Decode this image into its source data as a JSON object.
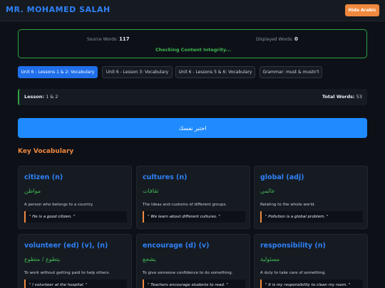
{
  "header": {
    "brand": "MR. MOHAMED SALAH",
    "hide_arabic_label": "Hide Arabic"
  },
  "integrity": {
    "source_label": "Source Words:",
    "source_value": "117",
    "displayed_label": "Displayed Words:",
    "displayed_value": "0",
    "status": "Checking Content Integrity..."
  },
  "tabs": [
    {
      "label": "Unit 6 - Lessons 1 & 2: Vocabulary",
      "active": true
    },
    {
      "label": "Unit 6 - Lesson 3: Vocabulary",
      "active": false
    },
    {
      "label": "Unit 6 - Lessons 5 & 6: Vocabulary",
      "active": false
    },
    {
      "label": "Grammar: must & mustn't",
      "active": false
    }
  ],
  "lesson": {
    "label": "Lesson:",
    "value": "1 & 2",
    "total_label": "Total Words:",
    "total_value": "53"
  },
  "test_button": "اختبر نفسك",
  "section_title": "Key Vocabulary",
  "cards": [
    {
      "word": "citizen (n)",
      "arabic": "مواطن",
      "definition": "A person who belongs to a country.",
      "example": "\" He is a good citizen. \""
    },
    {
      "word": "cultures (n)",
      "arabic": "ثقافات",
      "definition": "The ideas and customs of different groups.",
      "example": "\" We learn about different cultures. \""
    },
    {
      "word": "global (adj)",
      "arabic": "عالمي",
      "definition": "Relating to the whole world.",
      "example": "\" Pollution is a global problem. \""
    },
    {
      "word": "volunteer (ed) (v), (n)",
      "arabic": "يتطوع / متطوع",
      "definition": "To work without getting paid to help others.",
      "example": "\" I volunteer at the hospital. \""
    },
    {
      "word": "encourage (d) (v)",
      "arabic": "يشجع",
      "definition": "To give someone confidence to do something.",
      "example": "\" Teachers encourage students to read. \""
    },
    {
      "word": "responsibility (n)",
      "arabic": "مسئولية",
      "definition": "A duty to take care of something.",
      "example": "\" It is my responsibility to clean my room. \""
    }
  ],
  "colors": {
    "accent": "#1f8bff",
    "orange": "#f0883e",
    "green": "#3fb950"
  }
}
